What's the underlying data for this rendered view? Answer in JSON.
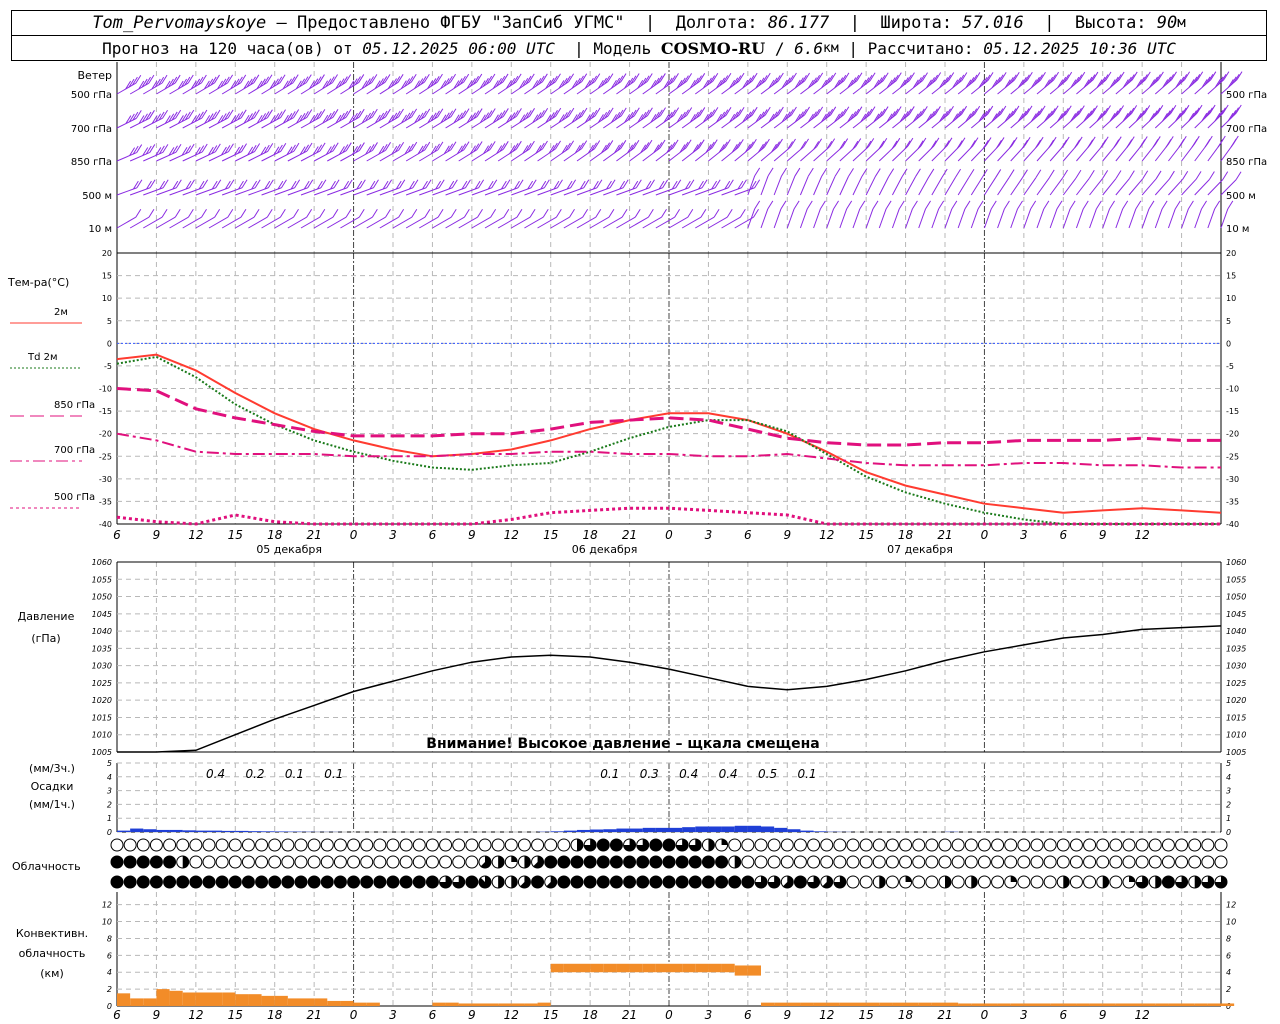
{
  "header": {
    "station": "Tom_Pervomayskoye",
    "provided_by": " – Предоставлено ФГБУ \"ЗапСиб УГМС\"  |  Долгота: ",
    "lon": "86.177",
    "lat_label": "  |  Широта: ",
    "lat": "57.016",
    "alt_label": "  |  Высота: ",
    "alt": "90",
    "alt_unit": "м",
    "forecast_label": "Прогноз на 120 часа(ов) от ",
    "forecast_from": "05.12.2025 06:00 UTC",
    "model_label": "  | Модель ",
    "model": "COSMO-RU",
    "sep": " / ",
    "resolution": "6.6",
    "res_unit": "км",
    "calc_label": " | Рассчитано: ",
    "calculated": "05.12.2025 10:36 UTC"
  },
  "wind": {
    "title": "Ветер",
    "levels": [
      "500 гПа",
      "700 гПа",
      "850 гПа",
      "500 м",
      "10  м"
    ],
    "color": "#8a2be2"
  },
  "temperature": {
    "title": "Тем-ра(°C)",
    "legend": [
      {
        "label": "2м",
        "color": "#ff3b30",
        "style": "solid"
      },
      {
        "label": "Td  2м",
        "color": "#1a7a1a",
        "style": "dotted"
      },
      {
        "label": "850 гПа",
        "color": "#e0107d",
        "style": "dash"
      },
      {
        "label": "700 гПа",
        "color": "#e0107d",
        "style": "dashdot"
      },
      {
        "label": "500 гПа",
        "color": "#e0107d",
        "style": "dot"
      }
    ],
    "yticks": [
      "20",
      "15",
      "10",
      "5",
      "0",
      "-5",
      "-10",
      "-15",
      "-20",
      "-25",
      "-30",
      "-35",
      "-40"
    ]
  },
  "time_axis": {
    "hours": [
      "6",
      "9",
      "12",
      "15",
      "18",
      "21",
      "0",
      "3",
      "6",
      "9",
      "12",
      "15",
      "18",
      "21",
      "0",
      "3",
      "6",
      "9",
      "12",
      "15",
      "18",
      "21",
      "0",
      "3",
      "6",
      "9",
      "12"
    ],
    "dates": [
      "05 декабря",
      "06 декабря",
      "07 декабря"
    ]
  },
  "pressure": {
    "title_1": "Давление",
    "title_2": "(гПа)",
    "yticks": [
      "1060",
      "1055",
      "1050",
      "1045",
      "1040",
      "1035",
      "1030",
      "1025",
      "1020",
      "1015",
      "1010",
      "1005"
    ],
    "warning": "Внимание! Высокое давление – щкала смещена"
  },
  "precip": {
    "label_1": "(мм/3ч.)",
    "label_2": "Осадки",
    "label_3": "(мм/1ч.)",
    "yticks": [
      "5",
      "4",
      "3",
      "2",
      "1",
      "0"
    ],
    "amounts": [
      {
        "hour": 6,
        "text": "0.4"
      },
      {
        "hour": 9,
        "text": "0.2"
      },
      {
        "hour": 12,
        "text": "0.1"
      },
      {
        "hour": 15,
        "text": "0.1"
      },
      {
        "hour": 36,
        "text": "0.1"
      },
      {
        "hour": 39,
        "text": "0.3"
      },
      {
        "hour": 42,
        "text": "0.4"
      },
      {
        "hour": 45,
        "text": "0.4"
      },
      {
        "hour": 48,
        "text": "0.5"
      },
      {
        "hour": 51,
        "text": "0.1"
      }
    ],
    "color": "#1f3fd6"
  },
  "cloud": {
    "title": "Облачность"
  },
  "convective": {
    "title_1": "Конвективн.",
    "title_2": "облачность",
    "title_3": "(км)",
    "yticks": [
      "12",
      "10",
      "8",
      "6",
      "4",
      "2",
      "0"
    ],
    "color": "#f28c28"
  },
  "chart_data": [
    {
      "type": "line",
      "name": "temperature",
      "x_hours_from_start": [
        0,
        3,
        6,
        9,
        12,
        15,
        18,
        21,
        24,
        27,
        30,
        33,
        36,
        39,
        42,
        45,
        48,
        51,
        54,
        57,
        60,
        63,
        66,
        69,
        72,
        75,
        78,
        81,
        84
      ],
      "ylim": [
        -40,
        20
      ],
      "series": [
        {
          "name": "2м",
          "values": [
            -3.5,
            -2.5,
            -6,
            -11,
            -15.5,
            -19,
            -21.5,
            -23.5,
            -25,
            -24.5,
            -23.5,
            -21.5,
            -19,
            -17,
            -15.5,
            -15.5,
            -17,
            -20,
            -24,
            -28.5,
            -31.5,
            -33.5,
            -35.5,
            -36.5,
            -37.5,
            -37,
            -36.5,
            -37,
            -37.5
          ]
        },
        {
          "name": "Td  2м",
          "values": [
            -4.5,
            -3,
            -7.5,
            -13.5,
            -18,
            -21.5,
            -24,
            -26,
            -27.5,
            -28,
            -27,
            -26.5,
            -24,
            -21,
            -18.5,
            -17,
            -17,
            -19.5,
            -24.5,
            -29.5,
            -33,
            -35.5,
            -37.5,
            -39,
            -40.5,
            -41.5,
            -42,
            -41.5,
            -42
          ]
        },
        {
          "name": "850 гПа",
          "values": [
            -10,
            -10.5,
            -14.5,
            -16.5,
            -18,
            -19.5,
            -20.5,
            -20.5,
            -20.5,
            -20,
            -20,
            -19,
            -17.5,
            -17,
            -16.5,
            -17,
            -19,
            -21,
            -22,
            -22.5,
            -22.5,
            -22,
            -22,
            -21.5,
            -21.5,
            -21.5,
            -21,
            -21.5,
            -21.5
          ]
        },
        {
          "name": "700 гПа",
          "values": [
            -20,
            -21.5,
            -24,
            -24.5,
            -24.5,
            -24.5,
            -25,
            -25,
            -25,
            -24.5,
            -24.5,
            -24,
            -24,
            -24.5,
            -24.5,
            -25,
            -25,
            -24.5,
            -25.5,
            -26.5,
            -27,
            -27,
            -27,
            -26.5,
            -26.5,
            -27,
            -27,
            -27.5,
            -27.5
          ]
        },
        {
          "name": "500 гПа",
          "values": [
            -38.5,
            -39.5,
            -40.5,
            -38,
            -39.5,
            -43,
            -45,
            -44,
            -43,
            -41.5,
            -39,
            -37.5,
            -37,
            -36.5,
            -36.5,
            -37,
            -37.5,
            -38,
            -40.5,
            -42.5,
            -43,
            -44,
            -44.5,
            -44.5,
            -44.5,
            -45,
            -44.5,
            -45,
            -45
          ]
        }
      ]
    },
    {
      "type": "line",
      "name": "pressure",
      "x_hours_from_start": [
        0,
        3,
        6,
        9,
        12,
        15,
        18,
        21,
        24,
        27,
        30,
        33,
        36,
        39,
        42,
        45,
        48,
        51,
        54,
        57,
        60,
        63,
        66,
        69,
        72,
        75,
        78,
        81,
        84
      ],
      "ylim": [
        1005,
        1060
      ],
      "series": [
        {
          "name": "pressure",
          "values": [
            1000,
            1002,
            1005.5,
            1010,
            1014.5,
            1018.5,
            1022.5,
            1025.5,
            1028.5,
            1031,
            1032.5,
            1033,
            1032.5,
            1031,
            1029,
            1026.5,
            1024,
            1023,
            1024,
            1026,
            1028.5,
            1031.5,
            1034,
            1036,
            1038,
            1039,
            1040.5,
            1041,
            1041.5
          ]
        }
      ]
    },
    {
      "type": "bar",
      "name": "precipitation_1h",
      "x_hours_from_start": [
        0,
        1,
        2,
        3,
        4,
        5,
        6,
        7,
        8,
        9,
        10,
        11,
        12,
        13,
        14,
        15,
        16,
        17,
        18,
        19,
        20,
        21,
        22,
        23,
        24,
        25,
        26,
        27,
        28,
        29,
        30,
        31,
        32,
        33,
        34,
        35,
        36,
        37,
        38,
        39,
        40,
        41,
        42,
        43,
        44,
        45,
        46,
        47,
        48,
        49,
        50,
        51,
        52,
        53,
        54,
        55,
        56,
        57,
        58,
        59,
        60,
        61,
        62,
        63,
        64,
        65,
        66,
        67,
        68,
        69,
        70,
        71,
        72,
        73,
        74,
        75,
        76,
        77,
        78,
        79,
        80,
        81,
        82,
        83,
        84
      ],
      "ylim": [
        0,
        5
      ],
      "values": [
        0.1,
        0.25,
        0.2,
        0.15,
        0.15,
        0.12,
        0.1,
        0.1,
        0.08,
        0.08,
        0.06,
        0.05,
        0.04,
        0.03,
        0.02,
        0.01,
        0.01,
        0,
        0,
        0,
        0,
        0,
        0,
        0,
        0,
        0,
        0,
        0,
        0,
        0,
        0,
        0,
        0.02,
        0.05,
        0.1,
        0.15,
        0.18,
        0.2,
        0.25,
        0.25,
        0.3,
        0.3,
        0.3,
        0.35,
        0.4,
        0.4,
        0.4,
        0.45,
        0.45,
        0.4,
        0.3,
        0.2,
        0.1,
        0.05,
        0.02,
        0.01,
        0,
        0,
        0,
        0,
        0,
        0,
        0,
        0.02,
        0,
        0,
        0,
        0,
        0,
        0,
        0,
        0,
        0,
        0,
        0,
        0,
        0,
        0,
        0,
        0,
        0,
        0,
        0,
        0,
        0
      ]
    },
    {
      "type": "bar",
      "name": "convective_cloud_top_km",
      "x_hours_from_start": [
        0,
        1,
        2,
        3,
        4,
        5,
        6,
        7,
        8,
        9,
        10,
        11,
        12,
        13,
        14,
        15,
        16,
        17,
        18,
        19,
        20,
        21,
        22,
        23,
        24,
        25,
        26,
        27,
        28,
        29,
        30,
        31,
        32,
        33,
        34,
        35,
        36,
        37,
        38,
        39,
        40,
        41,
        42,
        43,
        44,
        45,
        46,
        47,
        48,
        49,
        50,
        51,
        52,
        53,
        54,
        55,
        56,
        57,
        58,
        59,
        60,
        61,
        62,
        63,
        64,
        65,
        66,
        67,
        68,
        69,
        70,
        71,
        72,
        73,
        74,
        75,
        76,
        77,
        78,
        79,
        80,
        81,
        82,
        83,
        84
      ],
      "ylim": [
        0,
        13
      ],
      "bottom": [
        0,
        0,
        0,
        0,
        0,
        0,
        0,
        0,
        0,
        0,
        0,
        0,
        0,
        0,
        0,
        0,
        0,
        0,
        0,
        0,
        0,
        0,
        0,
        0,
        0,
        0,
        0,
        0,
        0,
        0,
        0,
        0,
        0,
        4,
        4,
        4,
        4,
        4,
        4,
        4,
        4,
        4,
        4,
        4,
        4,
        4,
        4,
        3.6,
        3.6,
        0,
        0,
        0,
        0,
        0,
        0,
        0,
        0,
        0,
        0,
        0,
        0,
        0,
        0,
        0,
        0,
        0,
        0,
        0,
        0,
        0,
        0,
        0,
        0,
        0,
        0,
        0,
        0,
        0,
        0,
        0,
        0,
        0,
        0,
        0,
        0
      ],
      "top": [
        1.5,
        0.9,
        0.9,
        2.0,
        1.8,
        1.6,
        1.6,
        1.6,
        1.6,
        1.4,
        1.4,
        1.2,
        1.2,
        0.9,
        0.9,
        0.9,
        0.6,
        0.6,
        0.4,
        0.4,
        0,
        0,
        0,
        0,
        0.4,
        0.4,
        0.3,
        0.3,
        0.3,
        0.3,
        0.3,
        0.3,
        0.4,
        5.0,
        5.0,
        5.0,
        5.0,
        5.0,
        5.0,
        5.0,
        5.0,
        5.0,
        5.0,
        5.0,
        5.0,
        5.0,
        5.0,
        4.8,
        4.8,
        0.4,
        0.4,
        0.4,
        0.4,
        0.4,
        0.4,
        0.4,
        0.4,
        0.4,
        0.4,
        0.4,
        0.4,
        0.4,
        0.4,
        0.4,
        0.3,
        0.3,
        0.3,
        0.3,
        0.3,
        0.3,
        0.3,
        0.3,
        0.3,
        0.3,
        0.3,
        0.3,
        0.3,
        0.3,
        0.3,
        0.3,
        0.3,
        0.3,
        0.3,
        0.3,
        0.3
      ]
    }
  ]
}
